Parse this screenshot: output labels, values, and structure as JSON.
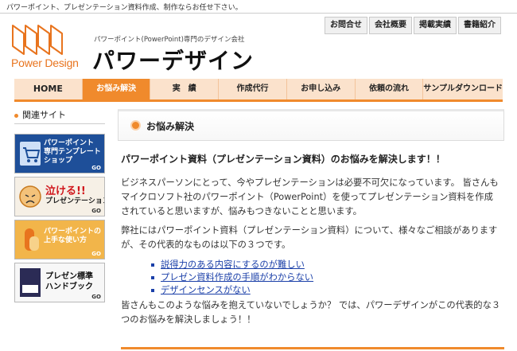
{
  "top_notice": "パワーポイント、プレゼンテーション資料作成、制作ならお任せ下さい。",
  "header": {
    "logo_text": "Power Design",
    "tagline": "パワーポイント(PowerPoint)専門のデザイン会社",
    "site_title": "パワーデザイン",
    "utility_links": [
      "お問合せ",
      "会社概要",
      "掲載実績",
      "書籍紹介"
    ]
  },
  "nav": {
    "items": [
      "HOME",
      "お悩み解決",
      "実　績",
      "作成代行",
      "お申し込み",
      "依頼の流れ",
      "サンプルダウンロード"
    ],
    "active_index": 1
  },
  "sidebar": {
    "heading": "関連サイト",
    "banners": [
      {
        "lines": [
          "パワーポイント",
          "専門テンプレート",
          "ショップ"
        ],
        "go": "GO"
      },
      {
        "lines": [
          "泣ける!!",
          "プレゼンテーション"
        ],
        "go": "GO"
      },
      {
        "lines": [
          "パワーポイントの",
          "上手な使い方"
        ],
        "go": "GO"
      },
      {
        "lines": [
          "プレゼン標準",
          "ハンドブック"
        ],
        "go": "GO"
      }
    ]
  },
  "main": {
    "page_heading": "お悩み解決",
    "lead": "パワーポイント資料（プレゼンテーション資料）のお悩みを解決します！！",
    "para1": "ビジネスパーソンにとって、今やプレゼンテーションは必要不可欠になっています。 皆さんもマイクロソフト社のパワーポイント（PowerPoint）を使ってプレゼンテーション資料を作成されていると思いますが、悩みもつきないことと思います。",
    "para2": "弊社にはパワーポイント資料（プレゼンテーション資料）について、様々なご相談がありますが、その代表的なものは以下の３つです。",
    "links": [
      "説得力のある内容にするのが難しい",
      "プレゼン資料作成の手順がわからない",
      "デザインセンスがない"
    ],
    "para3": "皆さんもこのような悩みを抱えていないでしょうか？ では、パワーデザインがこの代表的な３つのお悩みを解決しましょう！！"
  },
  "colors": {
    "accent": "#f08a2c",
    "nav_bg": "#fbe2cc",
    "link": "#1a3fa8"
  }
}
